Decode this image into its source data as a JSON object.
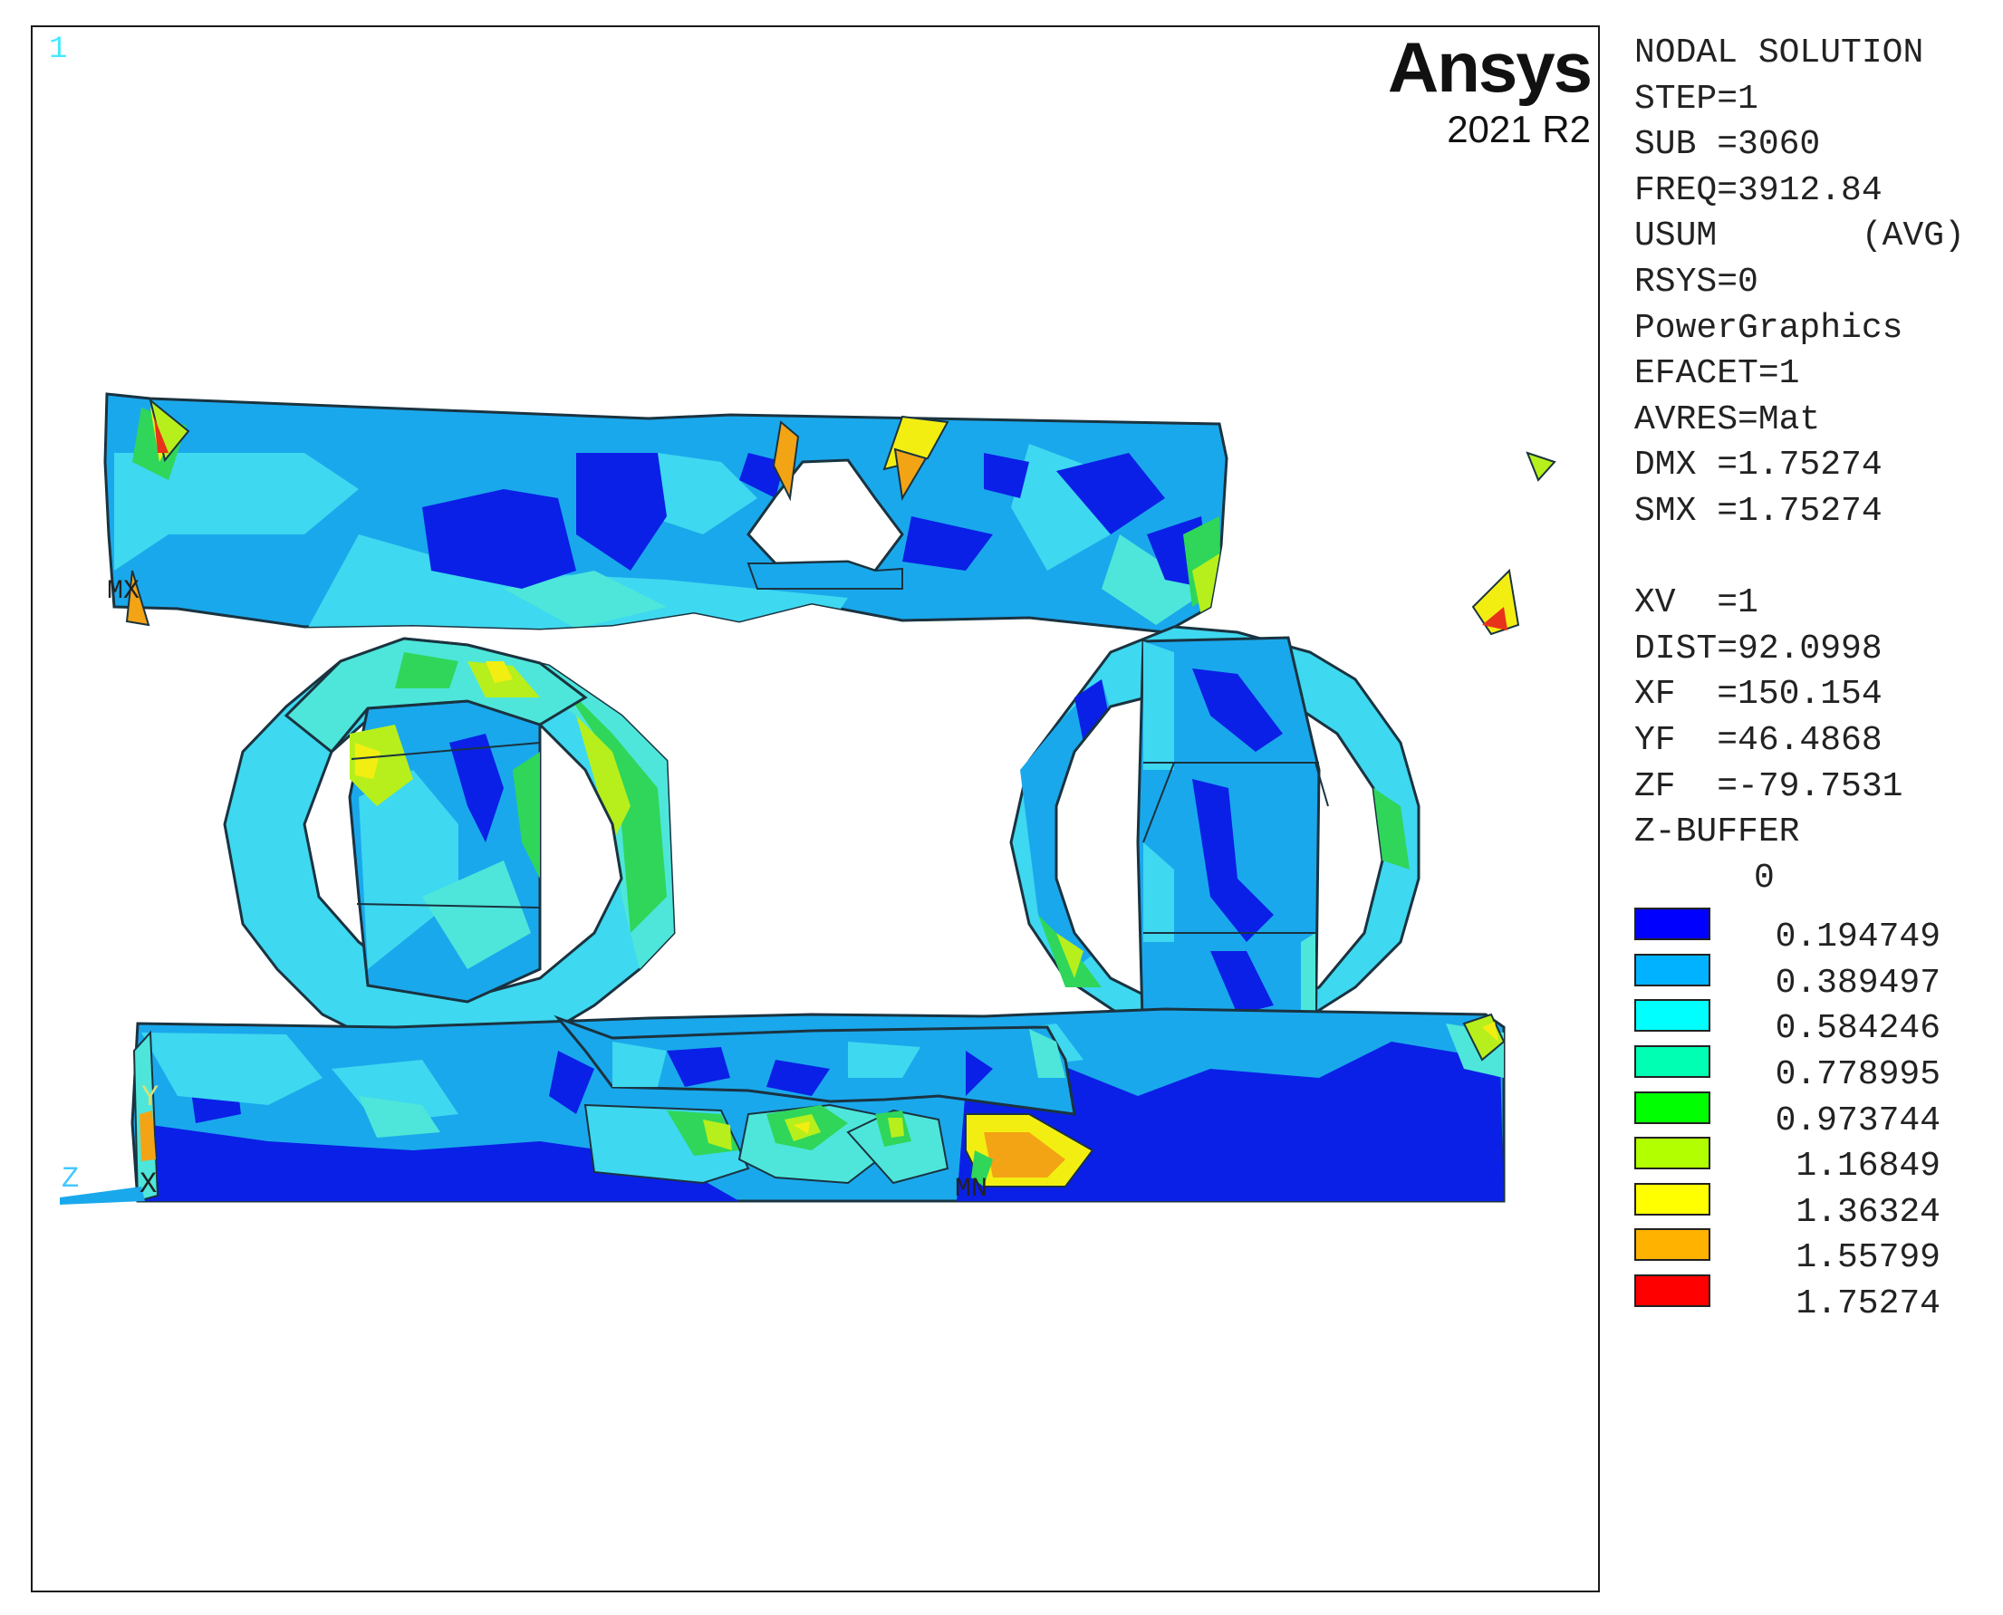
{
  "viewport": {
    "window_number": "1",
    "brand_name": "Ansys",
    "brand_version": "2021 R2",
    "background": "#ffffff",
    "markers": {
      "max_label": "MX",
      "min_label": "MN",
      "triad_y": "Y",
      "triad_z": "Z",
      "triad_x": "X"
    }
  },
  "info": {
    "lines": [
      "NODAL SOLUTION",
      "STEP=1",
      "SUB =3060",
      "FREQ=3912.84",
      "USUM       (AVG)",
      "RSYS=0",
      "PowerGraphics",
      "EFACET=1",
      "AVRES=Mat",
      "DMX =1.75274",
      "SMX =1.75274"
    ],
    "view_lines": [
      "XV  =1",
      "DIST=92.0998",
      "XF  =150.154",
      "YF  =46.4868",
      "ZF  =-79.7531",
      "Z-BUFFER"
    ]
  },
  "legend": {
    "zero_label": "0",
    "entries": [
      {
        "value": "0.194749",
        "color": "#0000ff"
      },
      {
        "value": "0.389497",
        "color": "#00b2ff"
      },
      {
        "value": "0.584246",
        "color": "#00ffff"
      },
      {
        "value": "0.778995",
        "color": "#00ffb2"
      },
      {
        "value": "0.973744",
        "color": "#00ff00"
      },
      {
        "value": "1.16849",
        "color": "#b2ff00"
      },
      {
        "value": "1.36324",
        "color": "#ffff00"
      },
      {
        "value": "1.55799",
        "color": "#ffb200"
      },
      {
        "value": "1.75274",
        "color": "#ff0000"
      }
    ]
  },
  "colors": {
    "deep_blue": "#0a20e6",
    "mid_blue": "#1aa8ec",
    "light_blue": "#3ed8f0",
    "aqua": "#4ee6da",
    "green": "#2fd65a",
    "yellow_green": "#b7ef1c",
    "yellow": "#f3ee12",
    "orange": "#f3a415",
    "red": "#e8331a"
  }
}
